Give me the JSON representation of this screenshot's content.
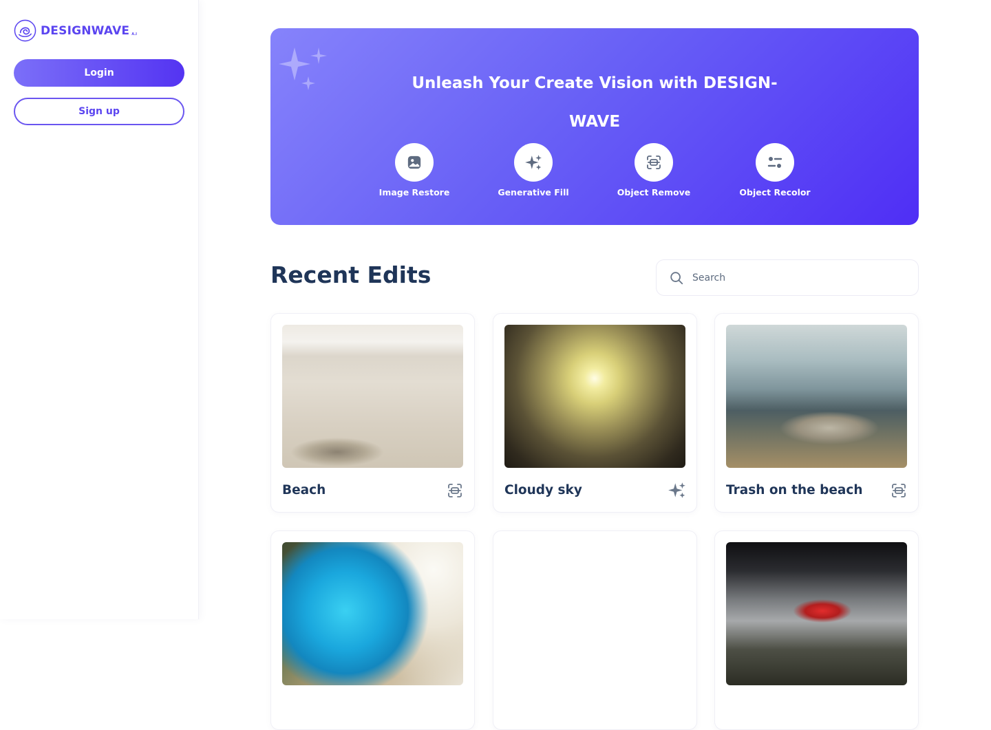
{
  "brand": {
    "name": "DESIGNWAVE",
    "suffix": "A.I",
    "accent": "#5b45f0"
  },
  "sidebar": {
    "login_label": "Login",
    "signup_label": "Sign up"
  },
  "hero": {
    "title_line1": "Unleash Your Create Vision with DESIGN-",
    "title_line2": "WAVE",
    "tools": [
      {
        "label": "Image Restore",
        "icon": "image-restore-icon"
      },
      {
        "label": "Generative Fill",
        "icon": "sparkles-icon"
      },
      {
        "label": "Object Remove",
        "icon": "object-remove-icon"
      },
      {
        "label": "Object Recolor",
        "icon": "recolor-icon"
      }
    ]
  },
  "recent": {
    "title": "Recent Edits",
    "search_placeholder": "Search",
    "cards": [
      {
        "title": "Beach",
        "icon": "object-remove-icon"
      },
      {
        "title": "Cloudy sky",
        "icon": "sparkles-icon"
      },
      {
        "title": "Trash on the beach",
        "icon": "object-remove-icon"
      },
      {
        "title": "",
        "icon": ""
      },
      {
        "title": "",
        "icon": ""
      },
      {
        "title": "",
        "icon": ""
      }
    ]
  }
}
